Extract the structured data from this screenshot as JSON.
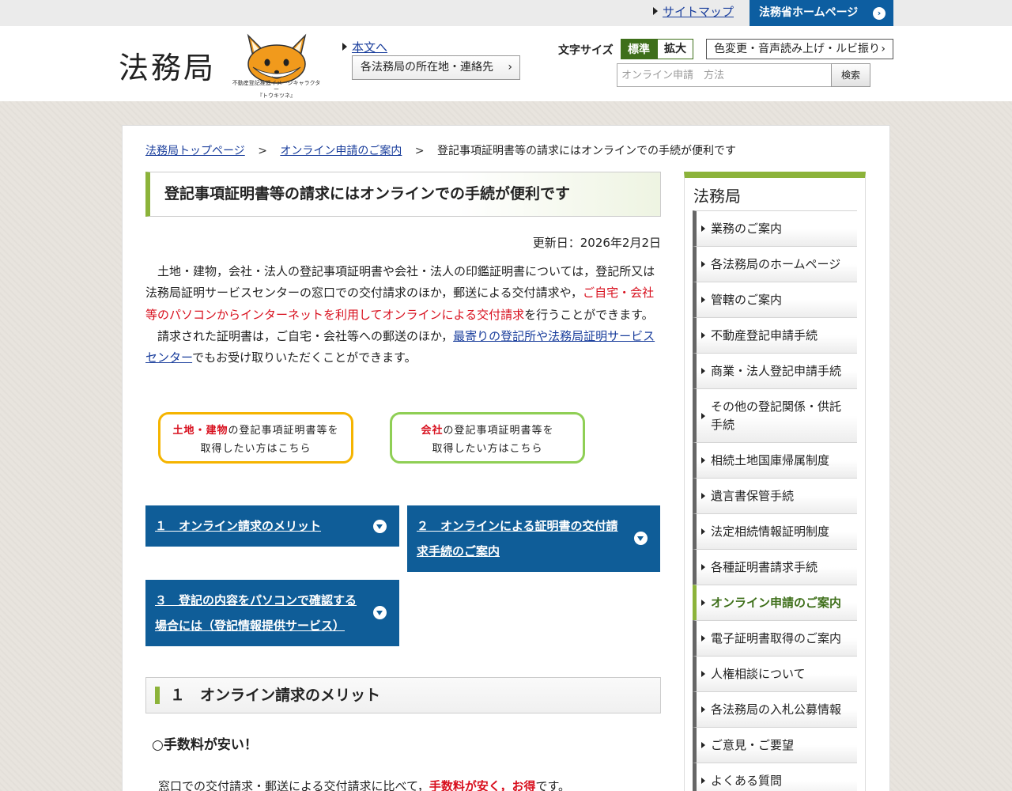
{
  "topbar": {
    "sitemap_label": "サイトマップ",
    "moj_home_label": "法務省ホームページ"
  },
  "header": {
    "logo_text": "法務局",
    "mascot_caption_line1": "不動産登記推進イメージキャラクター",
    "mascot_caption_line2": "『トウキツネ』",
    "skip_link": "本文へ",
    "offices_button": "各法務局の所在地・連絡先",
    "font_size_label": "文字サイズ",
    "font_standard": "標準",
    "font_large": "拡大",
    "color_button": "色変更・音声読み上げ・ルビ振り",
    "search_placeholder": "オンライン申請　方法",
    "search_button": "検索"
  },
  "breadcrumb": {
    "home": "法務局トップページ",
    "parent": "オンライン申請のご案内",
    "current": "登記事項証明書等の請求にはオンラインでの手続が便利です",
    "separator": ">"
  },
  "main": {
    "title": "登記事項証明書等の請求にはオンラインでの手続が便利です",
    "updated": "更新日：2026年2月2日",
    "intro_p1_a": "土地・建物，会社・法人の登記事項証明書や会社・法人の印鑑証明書については，登記所又は法務局証明サービスセンターの窓口での交付請求のほか，郵送による交付請求や，",
    "intro_p1_red": "ご自宅・会社等のパソコンからインターネットを利用してオンラインによる交付請求",
    "intro_p1_b": "を行うことができます。",
    "intro_p2_a": "請求された証明書は，ご自宅・会社等への郵送のほか，",
    "intro_p2_link": "最寄りの登記所や法務局証明サービスセンター",
    "intro_p2_b": "でもお受け取りいただくことができます。",
    "land_button_hl": "土地・建物",
    "land_button_rest": "の登記事項証明書等を",
    "land_button_line2": "取得したい方はこちら",
    "company_button_hl": "会社",
    "company_button_rest": "の登記事項証明書等を",
    "company_button_line2": "取得したい方はこちら",
    "accordion_1": "１　オンライン請求のメリット",
    "accordion_2_line1": "２　オンラインによる証明書の交付請",
    "accordion_2_line2": "求手続のご案内",
    "accordion_3_line1": "３　登記の内容をパソコンで確認する",
    "accordion_3_line2": "場合には（登記情報提供サービス）",
    "section_1_title": "１　オンライン請求のメリット",
    "sub_heading": "○手数料が安い！",
    "body_text_a": "窓口での交付請求・郵送による交付請求に比べて，",
    "body_text_red": "手数料が安く，お得",
    "body_text_b": "です。"
  },
  "sidebar": {
    "title": "法務局",
    "items": [
      {
        "label": "業務のご案内"
      },
      {
        "label": "各法務局のホームページ"
      },
      {
        "label": "管轄のご案内"
      },
      {
        "label": "不動産登記申請手続"
      },
      {
        "label": "商業・法人登記申請手続"
      },
      {
        "label": "その他の登記関係・供託手続"
      },
      {
        "label": "相続土地国庫帰属制度"
      },
      {
        "label": "遺言書保管手続"
      },
      {
        "label": "法定相続情報証明制度"
      },
      {
        "label": "各種証明書請求手続"
      },
      {
        "label": "オンライン申請のご案内"
      },
      {
        "label": "電子証明書取得のご案内"
      },
      {
        "label": "人権相談について"
      },
      {
        "label": "各法務局の入札公募情報"
      },
      {
        "label": "ご意見・ご要望"
      },
      {
        "label": "よくある質問"
      }
    ],
    "active_index": 10
  },
  "colors": {
    "primary_blue": "#0f5d98",
    "accent_green": "#8cb33a",
    "active_green": "#3e6f1a",
    "highlight_red": "#d8101e",
    "land_border": "#f5b400",
    "company_border": "#8fcf55"
  },
  "icons": {
    "sitemap": "triangle-right-icon",
    "moj_home": "circle-chevron-right-icon",
    "offices": "chevron-right-icon",
    "accordion": "circle-chevron-down-icon",
    "mascot": "fox-mascot-icon"
  }
}
